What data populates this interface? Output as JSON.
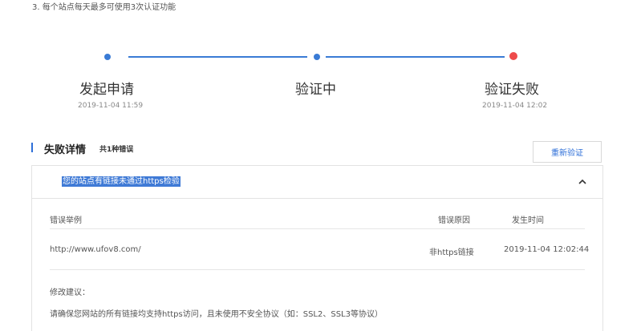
{
  "note": "3. 每个站点每天最多可使用3次认证功能",
  "steps": [
    {
      "title": "发起申请",
      "time": "2019-11-04 11:59"
    },
    {
      "title": "验证中",
      "time": ""
    },
    {
      "title": "验证失败",
      "time": "2019-11-04 12:02"
    }
  ],
  "colors": {
    "accent": "#3a7bd5",
    "fail": "#ee4b4b"
  },
  "section": {
    "title": "失败详情",
    "count": "共1种错误",
    "reverify_label": "重新验证"
  },
  "panel": {
    "header": "您的站点有链接未通过https检验",
    "columns": {
      "example": "错误举例",
      "reason": "错误原因",
      "time": "发生时间"
    },
    "rows": [
      {
        "example": "http://www.ufov8.com/",
        "reason": "非https链接",
        "time": "2019-11-04 12:02:44"
      }
    ],
    "advice_label": "修改建议：",
    "advice_text": "请确保您网站的所有链接均支持https访问，且未使用不安全协议（如：SSL2、SSL3等协议）"
  }
}
